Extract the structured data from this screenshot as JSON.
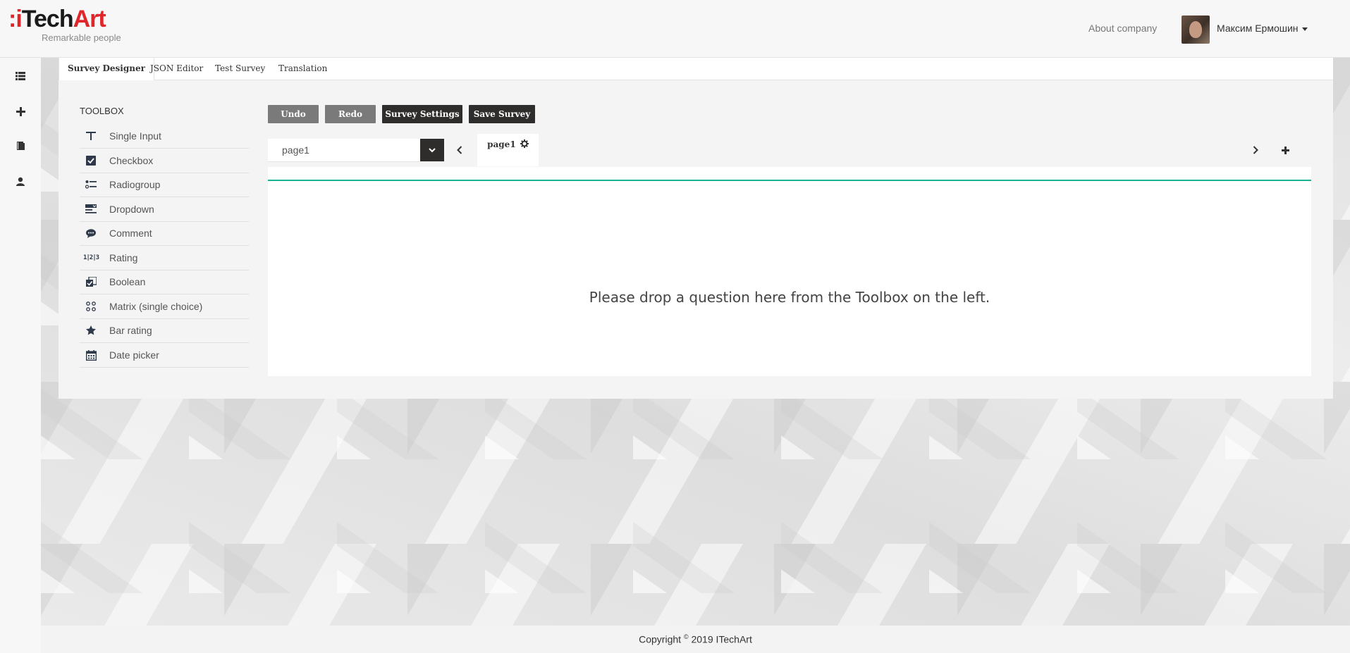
{
  "header": {
    "logo_main": "iTechArt",
    "logo_tagline": "Remarkable people",
    "about_link": "About company",
    "user_name": "Максим Ермошин"
  },
  "left_nav": {
    "icons": [
      "list-icon",
      "plus-icon",
      "book-icon",
      "user-icon"
    ]
  },
  "tabs": [
    "Survey Designer",
    "JSON Editor",
    "Test Survey",
    "Translation"
  ],
  "active_tab": "Survey Designer",
  "toolbox": {
    "title": "TOOLBOX",
    "items": [
      {
        "label": "Single Input",
        "icon": "text-icon"
      },
      {
        "label": "Checkbox",
        "icon": "checkbox-icon"
      },
      {
        "label": "Radiogroup",
        "icon": "radiogroup-icon"
      },
      {
        "label": "Dropdown",
        "icon": "dropdown-icon"
      },
      {
        "label": "Comment",
        "icon": "comment-icon"
      },
      {
        "label": "Rating",
        "icon": "rating-icon"
      },
      {
        "label": "Boolean",
        "icon": "boolean-icon"
      },
      {
        "label": "Matrix (single choice)",
        "icon": "matrix-icon"
      },
      {
        "label": "Bar rating",
        "icon": "star-icon"
      },
      {
        "label": "Date picker",
        "icon": "calendar-icon"
      }
    ]
  },
  "toolbar": {
    "undo": "Undo",
    "redo": "Redo",
    "survey_settings": "Survey Settings",
    "save_survey": "Save Survey"
  },
  "page_selector": {
    "value": "page1"
  },
  "page_tab": "page1",
  "drop_message": "Please drop a question here from the Toolbox on the left.",
  "footer": {
    "prefix": "Copyright ",
    "symbol": "©",
    "suffix": " 2019 ITechArt"
  },
  "colors": {
    "brand_red": "#e0262b",
    "accent_green": "#1ab394",
    "dark_button": "#2f2c2c",
    "gray_button": "#7a7a7a"
  }
}
